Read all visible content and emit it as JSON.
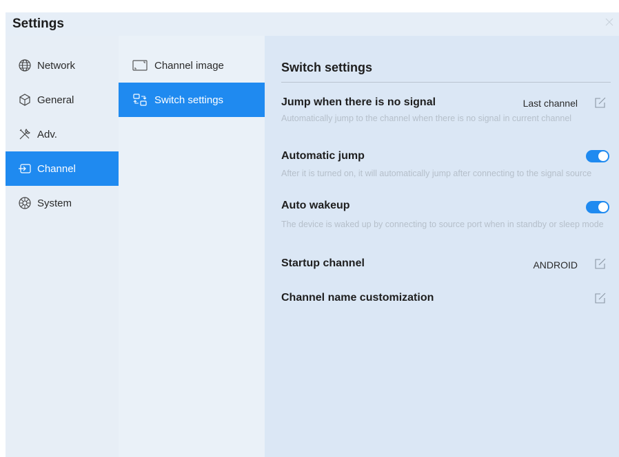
{
  "window": {
    "title": "Settings"
  },
  "nav": {
    "items": [
      {
        "label": "Network",
        "icon": "globe-icon"
      },
      {
        "label": "General",
        "icon": "cube-icon"
      },
      {
        "label": "Adv.",
        "icon": "tools-icon"
      },
      {
        "label": "Channel",
        "icon": "channel-input-icon",
        "active": true
      },
      {
        "label": "System",
        "icon": "system-gear-icon"
      }
    ]
  },
  "subnav": {
    "items": [
      {
        "label": "Channel image",
        "icon": "channel-image-icon"
      },
      {
        "label": "Switch settings",
        "icon": "switch-icon",
        "active": true
      }
    ]
  },
  "content": {
    "title": "Switch settings",
    "rows": [
      {
        "title": "Jump when there is no signal",
        "value": "Last channel",
        "desc": "Automatically jump to the channel when there is no signal in current channel"
      },
      {
        "title": "Automatic jump",
        "toggle": true,
        "desc": "After it is turned on, it will automatically jump after connecting to the signal source"
      },
      {
        "title": "Auto wakeup",
        "toggle": true,
        "desc": "The device is waked up by connecting to source port when in standby or sleep mode"
      },
      {
        "title": "Startup channel",
        "value": "ANDROID"
      },
      {
        "title": "Channel name customization"
      }
    ]
  },
  "colors": {
    "accent": "#1f8af0",
    "desc_text": "#b5bfca",
    "content_bg": "#dbe7f5"
  }
}
